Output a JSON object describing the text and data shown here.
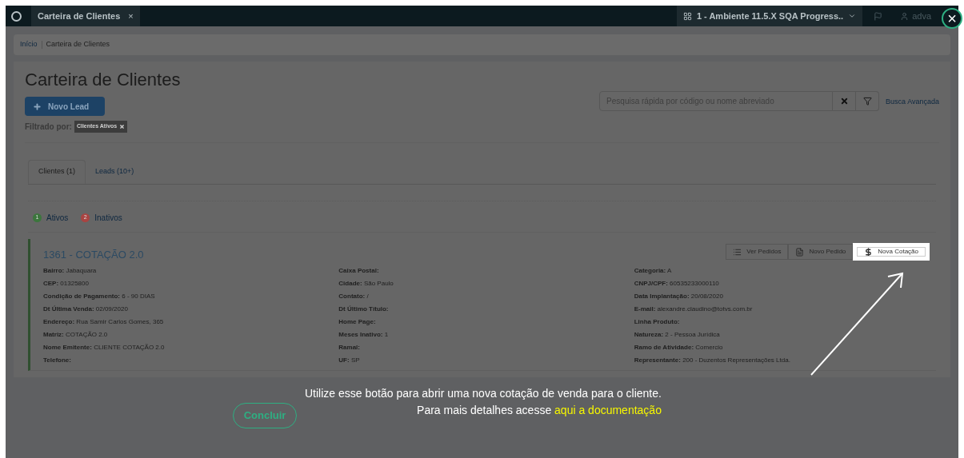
{
  "topbar": {
    "tab": {
      "label": "Carteira de Clientes",
      "close": "×"
    },
    "environment": "1 - Ambiente 11.5.X SQA Progress..",
    "user": "adva"
  },
  "breadcrumb": [
    "Início",
    "Carteira de Clientes"
  ],
  "page": {
    "title": "Carteira de Clientes",
    "new_lead": "Novo Lead",
    "filter_label": "Filtrado por:",
    "filter_tag": "Clientes Ativos",
    "search": {
      "placeholder": "Pesquisa rápida por código ou nome abreviado"
    },
    "advanced_search": "Busca Avançada"
  },
  "tabs": [
    {
      "label": "Clientes (1)",
      "selected": true
    },
    {
      "label": "Leads (10+)",
      "selected": false
    }
  ],
  "legend": [
    {
      "number": "1",
      "label": "Ativos",
      "color": "#3c763d"
    },
    {
      "number": "2",
      "label": "Inativos",
      "color": "#a94442"
    }
  ],
  "client": {
    "title": "1361 - COTAÇÃO 2.0",
    "actions": [
      {
        "kind": "list",
        "label": "Ver Pedidos",
        "highlighted": false
      },
      {
        "kind": "file",
        "label": "Novo Pedido",
        "highlighted": false
      },
      {
        "kind": "dollar",
        "label": "Nova Cotação",
        "highlighted": true
      }
    ],
    "columns": [
      [
        {
          "label": "Bairro:",
          "value": "Jabaquara"
        },
        {
          "label": "CEP:",
          "value": "01325800"
        },
        {
          "label": "Condição de Pagamento:",
          "value": "6 - 90 DIAS"
        },
        {
          "label": "Dt Última Venda:",
          "value": "02/09/2020"
        },
        {
          "label": "Endereço:",
          "value": "Rua Samir Carlos Gomes, 365"
        },
        {
          "label": "Matriz:",
          "value": "COTAÇÃO 2.0"
        },
        {
          "label": "Nome Emitente:",
          "value": "CLIENTE COTAÇÃO 2.0"
        },
        {
          "label": "Telefone:"
        }
      ],
      [
        {
          "label": "Caixa Postal:"
        },
        {
          "label": "Cidade:",
          "value": "São Paulo"
        },
        {
          "label": "Contato:",
          "value": "/"
        },
        {
          "label": "Dt Último Título:"
        },
        {
          "label": "Home Page:"
        },
        {
          "label": "Meses Inativo:",
          "value": "1"
        },
        {
          "label": "Ramal:"
        },
        {
          "label": "UF:",
          "value": "SP"
        }
      ],
      [
        {
          "label": "Categoria:",
          "value": "A"
        },
        {
          "label": "CNPJ/CPF:",
          "value": "60535233000110"
        },
        {
          "label": "Data Implantação:",
          "value": "20/08/2020"
        },
        {
          "label": "E-mail:",
          "value": "alexandre.claudino@totvs.com.br"
        },
        {
          "label": "Linha Produto:"
        },
        {
          "label": "Natureza:",
          "value": "2 - Pessoa Jurídica"
        },
        {
          "label": "Ramo de Atividade:",
          "value": "Comercio"
        },
        {
          "label": "Representante:",
          "value": "200 - Duzentos Representações Ltda."
        }
      ]
    ]
  },
  "tour": {
    "text": "Utilize esse botão para abrir uma nova cotação de venda para o cliente.",
    "more": "Para mais detalhes acesse",
    "link": "aqui a documentação",
    "finish": "Concluir",
    "close": "×"
  }
}
